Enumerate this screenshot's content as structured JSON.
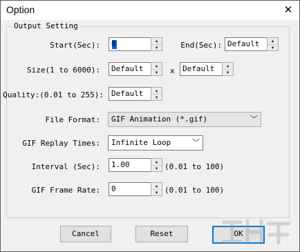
{
  "window": {
    "title": "Option",
    "close_glyph": "✕"
  },
  "group": {
    "title": "Output Setting"
  },
  "fields": {
    "start": {
      "label": "Start(Sec):",
      "value": "0"
    },
    "end": {
      "label": "End(Sec):",
      "value": "Default"
    },
    "size": {
      "label": "Size(1 to 6000):",
      "width": "Default",
      "sep": "x",
      "height": "Default"
    },
    "quality": {
      "label": "Quality:(0.01 to 255):",
      "value": "Default"
    },
    "file_format": {
      "label": "File Format:",
      "value": "GIF Animation (*.gif)"
    },
    "replay": {
      "label": "GIF Replay Times:",
      "value": "Infinite Loop"
    },
    "interval": {
      "label": "Interval (Sec):",
      "value": "1.00",
      "hint": "(0.01 to 100)"
    },
    "frame_rate": {
      "label": "GIF Frame Rate:",
      "value": "0",
      "hint": "(0.01 to 100)"
    }
  },
  "buttons": {
    "cancel": "Cancel",
    "reset": "Reset",
    "ok": "OK"
  },
  "icons": {
    "spin_up": "▲",
    "spin_down": "▼",
    "dropdown": "chevron-down-icon"
  },
  "colors": {
    "accent": "#0078d7",
    "background": "#f0f0f0"
  }
}
